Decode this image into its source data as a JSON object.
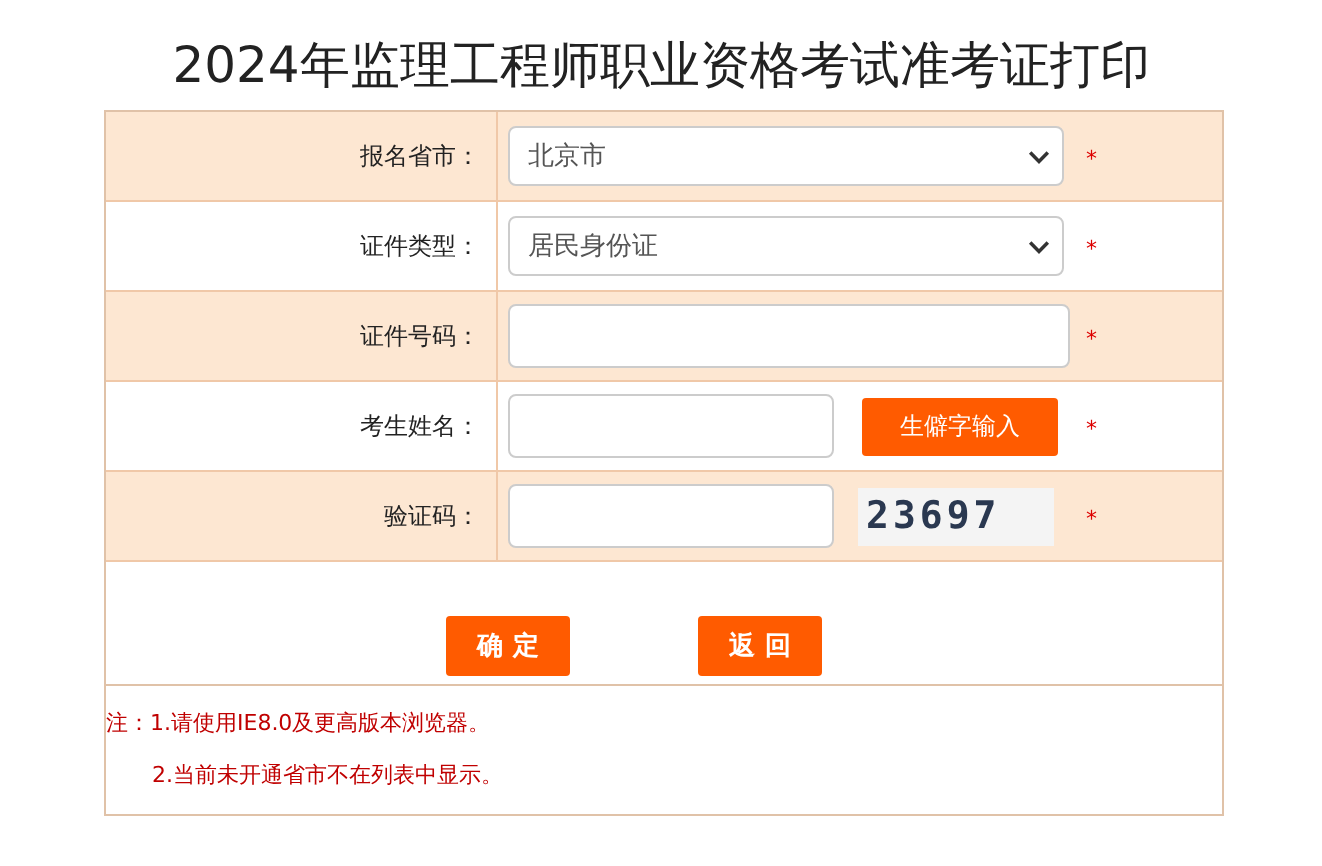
{
  "title": "2024年监理工程师职业资格考试准考证打印",
  "rows": [
    {
      "label": "报名省市：",
      "kind": "select",
      "value": "北京市",
      "required": "*"
    },
    {
      "label": "证件类型：",
      "kind": "select",
      "value": "居民身份证",
      "required": "*"
    },
    {
      "label": "证件号码：",
      "kind": "input",
      "required": "*"
    },
    {
      "label": "考生姓名：",
      "kind": "input_button",
      "button": "生僻字输入",
      "required": "*"
    },
    {
      "label": "验证码：",
      "kind": "captcha",
      "captcha": "23697",
      "required": "*"
    }
  ],
  "buttons": [
    "确 定",
    "返 回"
  ],
  "notes": [
    "注：1.请使用IE8.0及更高版本浏览器。",
    "2.当前未开通省市不在列表中显示。"
  ]
}
